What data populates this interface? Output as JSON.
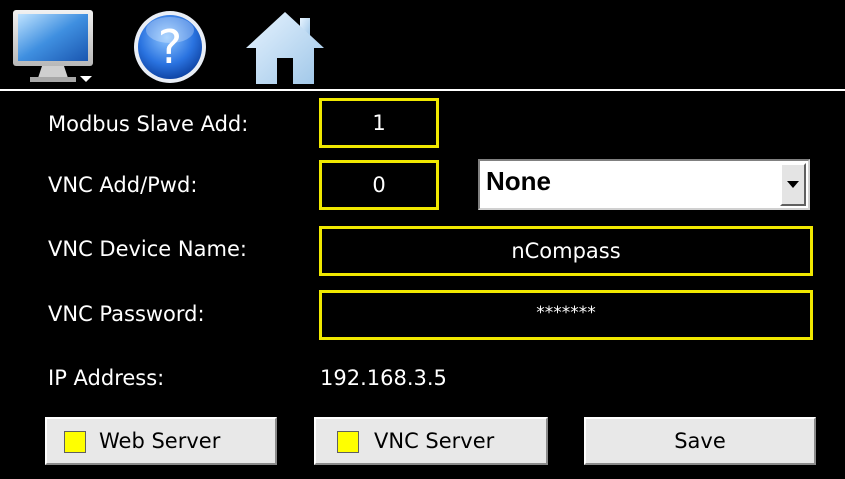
{
  "toolbar": {
    "icons": [
      "monitor-icon",
      "help-icon",
      "home-icon"
    ],
    "help_glyph": "?"
  },
  "settings": {
    "modbus_label": "Modbus Slave Add:",
    "modbus_value": "1",
    "vnc_add_label": "VNC Add/Pwd:",
    "vnc_add_value": "0",
    "vnc_mode_selected": "None",
    "vnc_name_label": "VNC Device Name:",
    "vnc_name_value": "nCompass",
    "vnc_password_label": "VNC Password:",
    "vnc_password_value": "*******",
    "ip_label": "IP Address:",
    "ip_value": "192.168.3.5"
  },
  "buttons": {
    "web_server": "Web Server",
    "vnc_server": "VNC Server",
    "save": "Save"
  },
  "colors": {
    "field_border": "#f0e800",
    "checkbox": "#ffff00",
    "background": "#000000"
  }
}
